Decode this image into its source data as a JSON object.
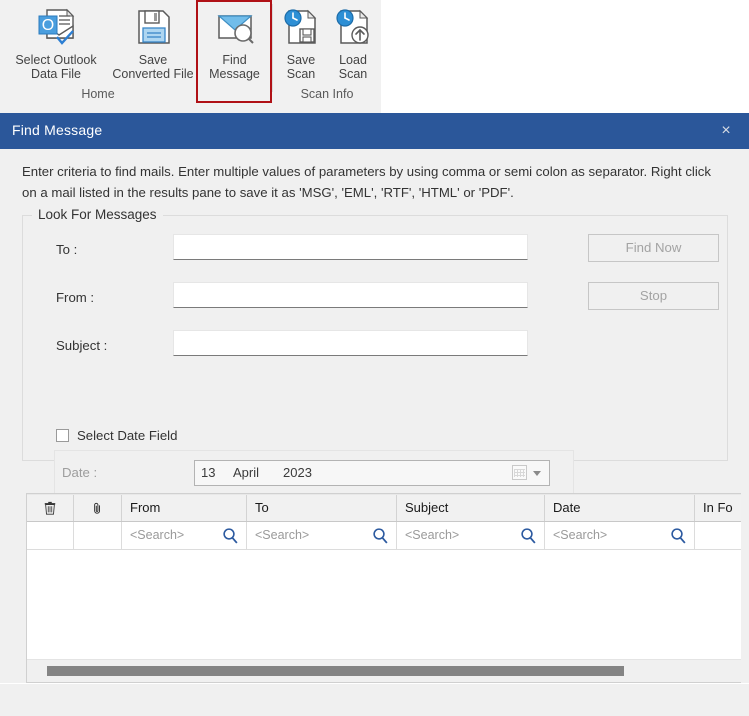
{
  "ribbon": {
    "buttons": [
      {
        "id": "select-outlook-data-file",
        "label": "Select Outlook\nData File",
        "icon": "outlook-data-file-icon"
      },
      {
        "id": "save-converted-file",
        "label": "Save\nConverted File",
        "icon": "floppy-disk-icon"
      },
      {
        "id": "find-message",
        "label": "Find\nMessage",
        "icon": "envelope-search-icon"
      },
      {
        "id": "save-scan",
        "label": "Save\nScan",
        "icon": "page-clock-save-icon"
      },
      {
        "id": "load-scan",
        "label": "Load\nScan",
        "icon": "page-clock-upload-icon"
      }
    ],
    "groups": [
      {
        "id": "home",
        "label": "Home"
      },
      {
        "id": "scan-info",
        "label": "Scan Info"
      }
    ],
    "highlight_color": "#b01116",
    "highlighted_button": "find-message"
  },
  "dialog": {
    "title": "Find Message",
    "title_bar_color": "#2b579a",
    "close_label": "×",
    "intro": "Enter criteria to find mails. Enter multiple values of parameters by using comma or semi colon as separator. Right click on a mail listed in the results pane to save it as 'MSG', 'EML', 'RTF', 'HTML' or 'PDF'.",
    "group": {
      "legend": "Look For Messages",
      "fields": [
        {
          "id": "to",
          "label": "To :",
          "value": "",
          "placeholder": ""
        },
        {
          "id": "from",
          "label": "From :",
          "value": "",
          "placeholder": ""
        },
        {
          "id": "subject",
          "label": "Subject :",
          "value": "",
          "placeholder": ""
        }
      ],
      "checkbox": {
        "label": "Select Date Field",
        "checked": false
      },
      "date": {
        "label": "Date :",
        "day": "13",
        "month": "April",
        "year": "2023",
        "enabled": false
      }
    },
    "buttons": [
      {
        "id": "find-now",
        "label": "Find Now",
        "enabled": false
      },
      {
        "id": "stop",
        "label": "Stop",
        "enabled": false
      }
    ]
  },
  "grid": {
    "columns": [
      {
        "id": "delete",
        "header": "",
        "icon": "trash-icon",
        "search": null
      },
      {
        "id": "attachment",
        "header": "",
        "icon": "paperclip-icon",
        "search": null
      },
      {
        "id": "from",
        "header": "From",
        "search": "<Search>"
      },
      {
        "id": "to",
        "header": "To",
        "search": "<Search>"
      },
      {
        "id": "subject",
        "header": "Subject",
        "search": "<Search>"
      },
      {
        "id": "date",
        "header": "Date",
        "search": "<Search>"
      },
      {
        "id": "in-folder",
        "header": "In Fo",
        "search": ""
      }
    ],
    "rows": [],
    "scrollbar": {
      "orientation": "horizontal",
      "thumb_color": "#848484"
    }
  }
}
